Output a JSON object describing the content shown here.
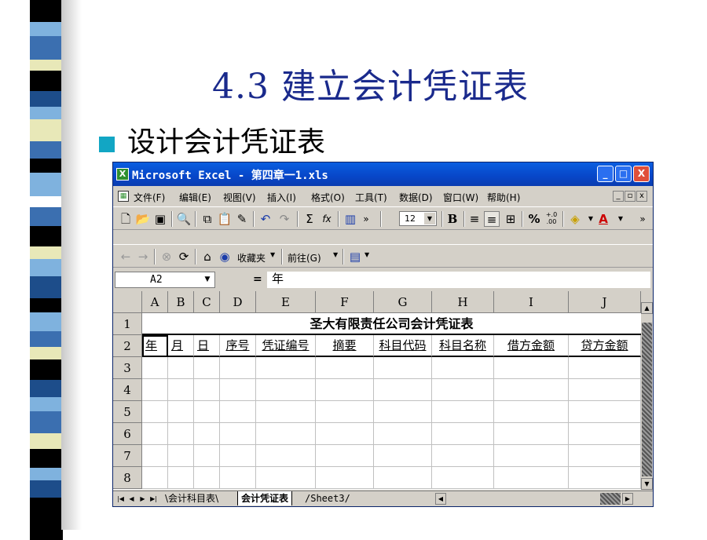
{
  "slide": {
    "title": "4.3  建立会计凭证表",
    "bullet": "设计会计凭证表"
  },
  "colors": {
    "title_color": "#1a2a8c",
    "bullet_color": "#12a6c4",
    "stripe_colors": [
      "#000000",
      "#3b6fb0",
      "#e8e8b8",
      "#7fb2de",
      "#1d4d8a",
      "#ffffff"
    ]
  },
  "window": {
    "title": "Microsoft Excel - 第四章一1.xls",
    "app_icon": "excel-icon",
    "buttons": {
      "minimize": "_",
      "maximize": "□",
      "close": "X"
    }
  },
  "menu": {
    "items": [
      "文件(F)",
      "编辑(E)",
      "视图(V)",
      "插入(I)",
      "格式(O)",
      "工具(T)",
      "数据(D)",
      "窗口(W)",
      "帮助(H)"
    ],
    "mdi_buttons": [
      "_",
      "▫",
      "x"
    ]
  },
  "toolbar": {
    "font_size": "12",
    "more": "»",
    "icons": [
      "new-icon",
      "open-icon",
      "save-icon",
      "print-preview-icon",
      "copy-icon",
      "paste-icon",
      "format-painter-icon",
      "undo-icon",
      "redo-icon",
      "autosum-icon",
      "function-icon",
      "chart-wizard-icon",
      "bold-icon",
      "align-left-icon",
      "align-center-icon",
      "merge-center-icon",
      "percent-icon",
      "increase-decimal-icon",
      "fill-color-icon",
      "font-color-icon"
    ],
    "labels": {
      "autosum": "Σ",
      "function": "fx",
      "bold": "B",
      "percent": "%",
      "decimal": "+.0\n.00",
      "font_color": "A"
    }
  },
  "webbar": {
    "favorites": "收藏夹",
    "goto": "前往(G)",
    "icons": [
      "back-icon",
      "forward-icon",
      "stop-icon",
      "refresh-icon",
      "home-icon",
      "search-web-icon",
      "show-only-web-toolbar-icon"
    ]
  },
  "formula": {
    "cell_ref": "A2",
    "equals": "=",
    "content": "年"
  },
  "sheet": {
    "columns": [
      "A",
      "B",
      "C",
      "D",
      "E",
      "F",
      "G",
      "H",
      "I",
      "J"
    ],
    "rows": [
      "1",
      "2",
      "3",
      "4",
      "5",
      "6",
      "7",
      "8"
    ],
    "title": "圣大有限责任公司会计凭证表",
    "headers": [
      "年",
      "月",
      "日",
      "序号",
      "凭证编号",
      "摘要",
      "科目代码",
      "科目名称",
      "借方金额",
      "贷方金额"
    ],
    "tabs": [
      "会计科目表",
      "会计凭证表",
      "Sheet3"
    ],
    "active_tab": 1
  }
}
